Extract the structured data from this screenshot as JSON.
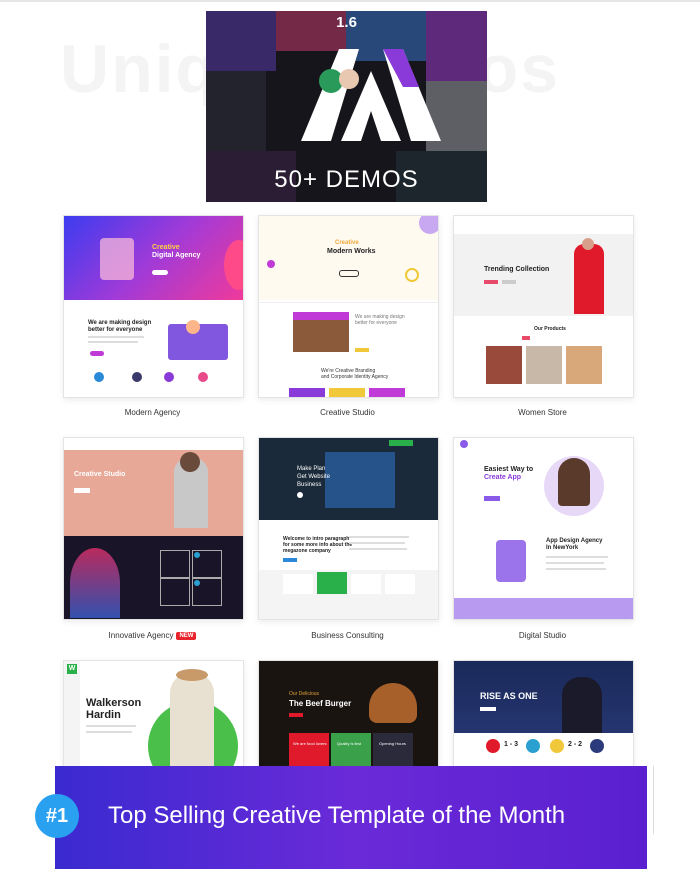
{
  "banner": {
    "watermark": "Unique Demos",
    "version": "1.6",
    "demos_label": "50+ DEMOS"
  },
  "demos": [
    {
      "caption": "Modern Agency",
      "hero_title": "Creative",
      "hero_sub": "Digital Agency",
      "line1": "We are making design",
      "line2": "better for everyone"
    },
    {
      "caption": "Creative Studio",
      "hero_title": "Creative",
      "hero_sub": "Modern Works",
      "line1": "We are making design",
      "line2": "better for everyone",
      "line3": "We're Creative Branding",
      "line4": "and Corporate Identity Agency"
    },
    {
      "caption": "Women Store",
      "hero_title": "Trending Collection",
      "line1": "Our Products"
    },
    {
      "caption": "Innovative Agency",
      "badge": "NEW",
      "hero_title": "Creative Studio"
    },
    {
      "caption": "Business Consulting",
      "hero_title": "Make Plan",
      "hero_sub": "Get Website",
      "hero_sub2": "Business",
      "line1": "Welcome to intro paragraph",
      "line2": "for some more info about the",
      "line3": "megazone company"
    },
    {
      "caption": "Digital Studio",
      "hero_title": "Easiest Way to",
      "hero_sub": "Create App",
      "line1": "App Design Agency",
      "line2": "In NewYork"
    },
    {
      "hero_title": "Walkerson",
      "hero_sub": "Hardin",
      "logo": "W"
    },
    {
      "hero_title": "Our Delicious",
      "hero_sub": "The Beef Burger",
      "tile1": "We are food lovers",
      "tile2": "Quality is first",
      "tile3": "Opening Hours"
    },
    {
      "hero_title": "RISE AS ONE",
      "score1": "1 - 3",
      "score2": "2 - 2"
    }
  ],
  "footer": {
    "rank": "#1",
    "title": "Top Selling Creative Template of the Month"
  },
  "colors": {
    "accent_purple": "#6a2ad8",
    "accent_blue": "#2aa0f0",
    "new_badge": "#e9232b"
  }
}
